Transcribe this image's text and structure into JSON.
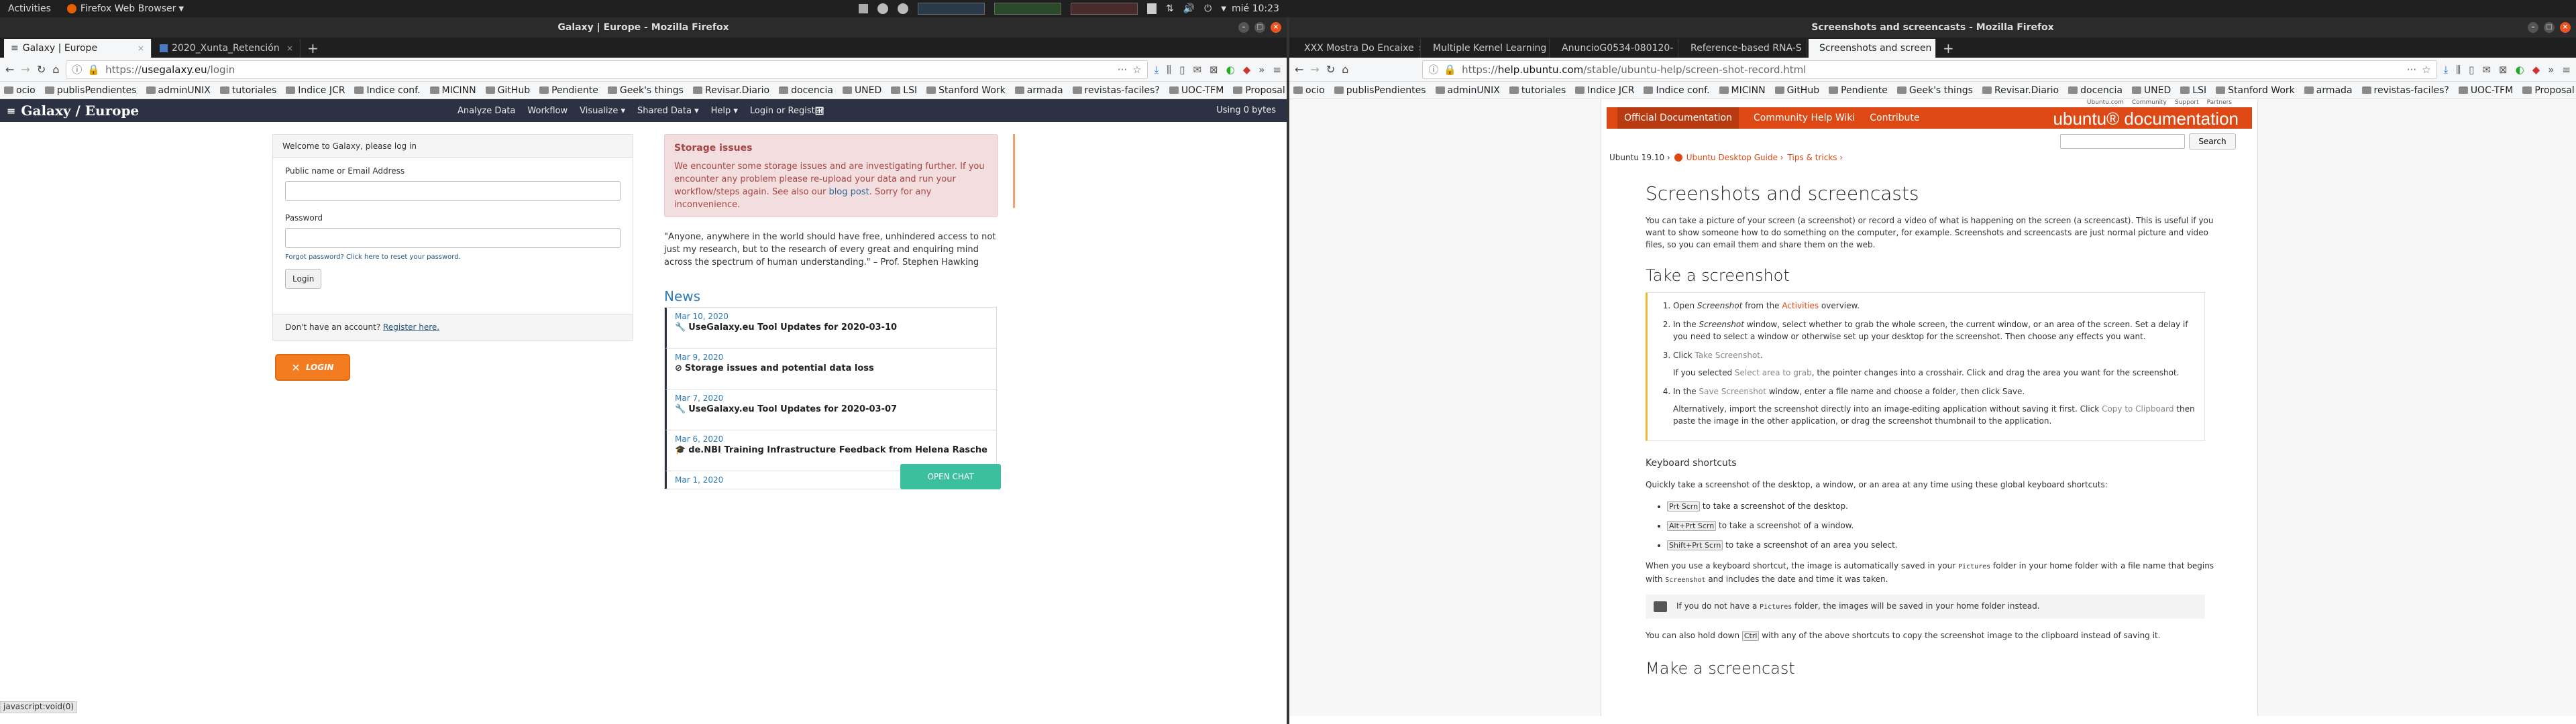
{
  "gnome": {
    "activities": "Activities",
    "app_menu": "Firefox Web Browser",
    "clock": "mié 10:23"
  },
  "left_window": {
    "title": "Galaxy | Europe - Mozilla Firefox",
    "tabs": [
      {
        "label": "Galaxy | Europe",
        "active": true
      },
      {
        "label": "2020_Xunta_Retención",
        "active": false
      }
    ],
    "url": {
      "prefix": "https://",
      "host": "usegalaxy.eu",
      "path": "/login"
    },
    "bookmarks": [
      "ocio",
      "publisPendientes",
      "adminUNIX",
      "tutoriales",
      "Indice JCR",
      "Indice conf.",
      "MICINN",
      "GitHub",
      "Pendiente",
      "Geek's things",
      "Revisar.Diario",
      "docencia",
      "UNED",
      "LSI",
      "Stanford Work",
      "armada",
      "revistas-faciles?",
      "UOC-TFM",
      "Proposal"
    ],
    "galaxy": {
      "brand": "Galaxy / Europe",
      "nav": [
        "Analyze Data",
        "Workflow",
        "Visualize ▾",
        "Shared Data ▾",
        "Help ▾",
        "Login or Register"
      ],
      "using": "Using 0 bytes",
      "login": {
        "header": "Welcome to Galaxy, please log in",
        "name_label": "Public name or Email Address",
        "password_label": "Password",
        "forgot_prefix": "Forgot password?",
        "forgot_link": "Click here to reset your password.",
        "button": "Login",
        "no_account": "Don't have an account?",
        "register": "Register here."
      },
      "elixir_label": "LOGIN",
      "storage": {
        "title": "Storage issues",
        "text_before": "We encounter some storage issues and are investigating further. If you encounter any problem please re-upload your data and run your workflow/steps again. See also our ",
        "link": "blog post",
        "text_after": ". Sorry for any inconvenience."
      },
      "quote": "\"Anyone, anywhere in the world should have free, unhindered access to not just my research, but to the research of every great and enquiring mind across the spectrum of human understanding.\" – Prof. Stephen Hawking",
      "news_title": "News",
      "news": [
        {
          "date": "Mar 10, 2020",
          "icon": "🔧",
          "title": "UseGalaxy.eu Tool Updates for 2020-03-10"
        },
        {
          "date": "Mar 9, 2020",
          "icon": "⊘",
          "title": "Storage issues and potential data loss"
        },
        {
          "date": "Mar 7, 2020",
          "icon": "🔧",
          "title": "UseGalaxy.eu Tool Updates for 2020-03-07"
        },
        {
          "date": "Mar 6, 2020",
          "icon": "🎓",
          "title": "de.NBI Training Infrastructure Feedback from Helena Rasche"
        },
        {
          "date": "Mar 1, 2020",
          "icon": "",
          "title": ""
        }
      ],
      "chat": "OPEN CHAT",
      "status": "javascript:void(0)"
    }
  },
  "right_window": {
    "title": "Screenshots and screencasts - Mozilla Firefox",
    "tabs": [
      {
        "label": "XXX Mostra Do Encaixe",
        "active": false
      },
      {
        "label": "Multiple Kernel Learning",
        "active": false
      },
      {
        "label": "AnuncioG0534-080120-",
        "active": false
      },
      {
        "label": "Reference-based RNA-S",
        "active": false
      },
      {
        "label": "Screenshots and screen",
        "active": true
      }
    ],
    "url": {
      "prefix": "https://",
      "host": "help.ubuntu.com",
      "path": "/stable/ubuntu-help/screen-shot-record.html"
    },
    "bookmarks": [
      "ocio",
      "publisPendientes",
      "adminUNIX",
      "tutoriales",
      "Indice JCR",
      "Indice conf.",
      "MICINN",
      "GitHub",
      "Pendiente",
      "Geek's things",
      "Revisar.Diario",
      "docencia",
      "UNED",
      "LSI",
      "Stanford Work",
      "armada",
      "revistas-faciles?",
      "UOC-TFM",
      "Proposal"
    ],
    "ubuntu": {
      "top_links": [
        "Ubuntu.com",
        "Community",
        "Support",
        "Partners"
      ],
      "nav": [
        "Official Documentation",
        "Community Help Wiki",
        "Contribute"
      ],
      "logo": "ubuntu® documentation",
      "search_button": "Search",
      "crumbs": {
        "release": "Ubuntu 19.10 ›",
        "guide": "Ubuntu Desktop Guide ›",
        "tips": "Tips & tricks ›"
      },
      "title": "Screenshots and screencasts",
      "intro": "You can take a picture of your screen (a screenshot) or record a video of what is happening on the screen (a screencast). This is useful if you want to show someone how to do something on the computer, for example. Screenshots and screencasts are just normal picture and video files, so you can email them and share them on the web.",
      "h_take": "Take a screenshot",
      "steps": [
        {
          "a": "Open ",
          "b": "Screenshot",
          "c": " from the ",
          "d": "Activities",
          "e": " overview."
        },
        {
          "a": "In the ",
          "b": "Screenshot",
          "c": " window, select whether to grab the whole screen, the current window, or an area of the screen. Set a delay if you need to select a window or otherwise set up your desktop for the screenshot. Then choose any effects you want.",
          "d": "",
          "e": ""
        },
        {
          "a": "Click ",
          "b": "",
          "c": "",
          "d": "Take Screenshot",
          "e": "."
        },
        {
          "a": "In the ",
          "b": "",
          "c": "",
          "d": "Save Screenshot",
          "e": " window, enter a file name and choose a folder, then click Save."
        }
      ],
      "step3_note": {
        "a": "If you selected ",
        "b": "Select area to grab",
        "c": ", the pointer changes into a crosshair. Click and drag the area you want for the screenshot."
      },
      "step4_note": {
        "a": "Alternatively, import the screenshot directly into an image-editing application without saving it first. Click ",
        "b": "Copy to Clipboard",
        "c": " then paste the image in the other application, or drag the screenshot thumbnail to the application."
      },
      "h_kbd": "Keyboard shortcuts",
      "kbd_intro": "Quickly take a screenshot of the desktop, a window, or an area at any time using these global keyboard shortcuts:",
      "shortcuts": [
        {
          "keys": "Prt Scrn",
          "text": " to take a screenshot of the desktop."
        },
        {
          "keys": "Alt+Prt Scrn",
          "text": " to take a screenshot of a window."
        },
        {
          "keys": "Shift+Prt Scrn",
          "text": " to take a screenshot of an area you select."
        }
      ],
      "saved_a": "When you use a keyboard shortcut, the image is automatically saved in your ",
      "saved_b": "Pictures",
      "saved_c": " folder in your home folder with a file name that begins with ",
      "saved_d": "Screenshot",
      "saved_e": " and includes the date and time it was taken.",
      "note_a": "If you do not have a ",
      "note_b": "Pictures",
      "note_c": " folder, the images will be saved in your home folder instead.",
      "ctrl_a": "You can also hold down ",
      "ctrl_b": "Ctrl",
      "ctrl_c": " with any of the above shortcuts to copy the screenshot image to the clipboard instead of saving it.",
      "h_cast": "Make a screencast"
    }
  }
}
